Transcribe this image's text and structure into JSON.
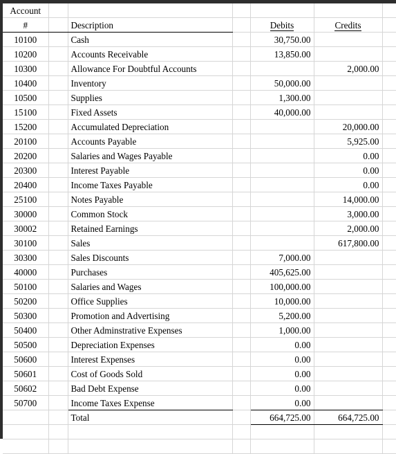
{
  "document": {
    "type": "spreadsheet-trial-balance",
    "header": {
      "account_label_line1": "Account",
      "account_label_line2": "#",
      "description": "Description",
      "debits": "Debits",
      "credits": "Credits"
    },
    "total_label": "Total",
    "totals": {
      "debits": "664,725.00",
      "credits": "664,725.00"
    },
    "rows": [
      {
        "account": "10100",
        "description": "Cash",
        "debit": "30,750.00",
        "credit": ""
      },
      {
        "account": "10200",
        "description": "Accounts Receivable",
        "debit": "13,850.00",
        "credit": ""
      },
      {
        "account": "10300",
        "description": "Allowance For Doubtful Accounts",
        "debit": "",
        "credit": "2,000.00"
      },
      {
        "account": "10400",
        "description": "Inventory",
        "debit": "50,000.00",
        "credit": ""
      },
      {
        "account": "10500",
        "description": "Supplies",
        "debit": "1,300.00",
        "credit": ""
      },
      {
        "account": "15100",
        "description": "Fixed Assets",
        "debit": "40,000.00",
        "credit": ""
      },
      {
        "account": "15200",
        "description": "Accumulated Depreciation",
        "debit": "",
        "credit": "20,000.00"
      },
      {
        "account": "20100",
        "description": "Accounts Payable",
        "debit": "",
        "credit": "5,925.00"
      },
      {
        "account": "20200",
        "description": "Salaries and Wages Payable",
        "debit": "",
        "credit": "0.00"
      },
      {
        "account": "20300",
        "description": "Interest Payable",
        "debit": "",
        "credit": "0.00"
      },
      {
        "account": "20400",
        "description": "Income Taxes Payable",
        "debit": "",
        "credit": "0.00"
      },
      {
        "account": "25100",
        "description": "Notes Payable",
        "debit": "",
        "credit": "14,000.00"
      },
      {
        "account": "30000",
        "description": "Common Stock",
        "debit": "",
        "credit": "3,000.00"
      },
      {
        "account": "30002",
        "description": "Retained Earnings",
        "debit": "",
        "credit": "2,000.00"
      },
      {
        "account": "30100",
        "description": "Sales",
        "debit": "",
        "credit": "617,800.00"
      },
      {
        "account": "30300",
        "description": "Sales Discounts",
        "debit": "7,000.00",
        "credit": ""
      },
      {
        "account": "40000",
        "description": "Purchases",
        "debit": "405,625.00",
        "credit": ""
      },
      {
        "account": "50100",
        "description": "Salaries and Wages",
        "debit": "100,000.00",
        "credit": ""
      },
      {
        "account": "50200",
        "description": "Office Supplies",
        "debit": "10,000.00",
        "credit": ""
      },
      {
        "account": "50300",
        "description": "Promotion and Advertising",
        "debit": "5,200.00",
        "credit": ""
      },
      {
        "account": "50400",
        "description": "Other Adminstrative Expenses",
        "debit": "1,000.00",
        "credit": ""
      },
      {
        "account": "50500",
        "description": "Depreciation Expenses",
        "debit": "0.00",
        "credit": ""
      },
      {
        "account": "50600",
        "description": "Interest Expenses",
        "debit": "0.00",
        "credit": ""
      },
      {
        "account": "50601",
        "description": "Cost of Goods Sold",
        "debit": "0.00",
        "credit": ""
      },
      {
        "account": "50602",
        "description": "Bad Debt Expense",
        "debit": "0.00",
        "credit": ""
      },
      {
        "account": "50700",
        "description": "Income Taxes Expense",
        "debit": "0.00",
        "credit": ""
      }
    ]
  },
  "colors": {
    "grid_line": "#d6d6d6",
    "rule": "#000000",
    "chrome": "#2e2e2e",
    "background": "#ffffff",
    "text": "#000000"
  }
}
